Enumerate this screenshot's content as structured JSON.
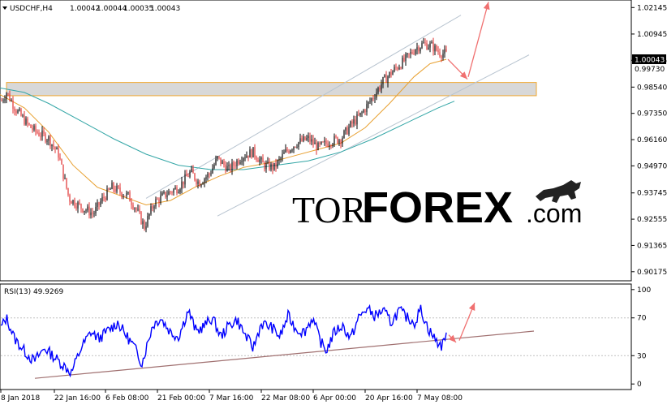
{
  "chart_data": [
    {
      "type": "candlestick",
      "header": {
        "symbol_timeframe": "USDCHF,H4",
        "ohlc": [
          "1.00042",
          "1.00044",
          "1.00035",
          "1.00043"
        ]
      },
      "price_label": "1.00043",
      "sub_price_label": "0.99730",
      "y_ticks": [
        0.90175,
        0.91365,
        0.92555,
        0.93745,
        0.9497,
        0.9616,
        0.9735,
        0.9854,
        0.99755,
        1.00945,
        1.02145
      ],
      "y_tick_labels": [
        "0.90175",
        "0.91365",
        "0.92555",
        "0.93745",
        "0.94970",
        "0.96160",
        "0.97350",
        "0.98540",
        "0.99755",
        "1.00945",
        "1.02145"
      ],
      "ylim": [
        0.898,
        1.0245
      ],
      "x_ticks": [
        "8 Jan 2018",
        "22 Jan 16:00",
        "6 Feb 08:00",
        "21 Feb 00:00",
        "7 Mar 16:00",
        "22 Mar 08:00",
        "6 Apr 00:00",
        "20 Apr 16:00",
        "7 May 08:00"
      ],
      "price_path": [
        [
          0,
          0.978
        ],
        [
          8,
          0.983
        ],
        [
          20,
          0.975
        ],
        [
          35,
          0.968
        ],
        [
          45,
          0.965
        ],
        [
          60,
          0.962
        ],
        [
          72,
          0.955
        ],
        [
          85,
          0.935
        ],
        [
          100,
          0.931
        ],
        [
          115,
          0.928
        ],
        [
          125,
          0.934
        ],
        [
          138,
          0.94
        ],
        [
          148,
          0.938
        ],
        [
          158,
          0.936
        ],
        [
          168,
          0.93
        ],
        [
          178,
          0.922
        ],
        [
          190,
          0.933
        ],
        [
          205,
          0.937
        ],
        [
          220,
          0.94
        ],
        [
          235,
          0.947
        ],
        [
          245,
          0.942
        ],
        [
          258,
          0.946
        ],
        [
          268,
          0.953
        ],
        [
          282,
          0.948
        ],
        [
          298,
          0.954
        ],
        [
          312,
          0.956
        ],
        [
          325,
          0.95
        ],
        [
          338,
          0.949
        ],
        [
          352,
          0.956
        ],
        [
          365,
          0.96
        ],
        [
          380,
          0.962
        ],
        [
          392,
          0.958
        ],
        [
          408,
          0.961
        ],
        [
          420,
          0.962
        ],
        [
          432,
          0.968
        ],
        [
          445,
          0.973
        ],
        [
          458,
          0.98
        ],
        [
          472,
          0.988
        ],
        [
          485,
          0.993
        ],
        [
          500,
          0.998
        ],
        [
          512,
          1.003
        ],
        [
          522,
          1.005
        ],
        [
          532,
          1.004
        ],
        [
          542,
          1.001
        ],
        [
          550,
          1.0004
        ]
      ],
      "ma_fast": [
        [
          0,
          0.982
        ],
        [
          30,
          0.976
        ],
        [
          60,
          0.965
        ],
        [
          90,
          0.95
        ],
        [
          120,
          0.94
        ],
        [
          150,
          0.936
        ],
        [
          180,
          0.932
        ],
        [
          210,
          0.934
        ],
        [
          240,
          0.94
        ],
        [
          270,
          0.945
        ],
        [
          300,
          0.949
        ],
        [
          330,
          0.951
        ],
        [
          360,
          0.954
        ],
        [
          390,
          0.957
        ],
        [
          420,
          0.96
        ],
        [
          450,
          0.967
        ],
        [
          480,
          0.978
        ],
        [
          510,
          0.99
        ],
        [
          530,
          0.996
        ],
        [
          550,
          0.998
        ]
      ],
      "ma_slow": [
        [
          0,
          0.985
        ],
        [
          30,
          0.983
        ],
        [
          60,
          0.978
        ],
        [
          100,
          0.97
        ],
        [
          140,
          0.962
        ],
        [
          180,
          0.955
        ],
        [
          220,
          0.95
        ],
        [
          260,
          0.948
        ],
        [
          300,
          0.948
        ],
        [
          340,
          0.95
        ],
        [
          380,
          0.952
        ],
        [
          420,
          0.956
        ],
        [
          460,
          0.962
        ],
        [
          500,
          0.969
        ],
        [
          540,
          0.976
        ],
        [
          560,
          0.979
        ]
      ],
      "resistance_zone": [
        0.9815,
        0.9875
      ],
      "channel_upper": [
        [
          180,
          0.935
        ],
        [
          568,
          1.018
        ]
      ],
      "channel_lower": [
        [
          268,
          0.927
        ],
        [
          652,
          1.0
        ]
      ],
      "forecast_arrows": [
        [
          [
            552,
            0.998
          ],
          [
            576,
            0.989
          ]
        ],
        [
          [
            577,
            0.99
          ],
          [
            602,
            1.024
          ]
        ]
      ],
      "colors": {
        "bull": "#000000",
        "bear": "#e03030",
        "ma_fast": "#e8a030",
        "ma_slow": "#33a6a6",
        "channel": "#b8c4d0",
        "zone_fill": "#d8d8d8",
        "zone_border": "#f0a830",
        "arrow": "#f07070",
        "price_label_bg": "#000000",
        "price_label_fg": "#ffffff"
      },
      "watermark": {
        "tor": "TOR",
        "forex": "FOREX",
        "com": ".com",
        "colors": {
          "tor": "#222222",
          "forex": "#ff3300",
          "com": "#222222"
        }
      }
    },
    {
      "type": "line",
      "header": "RSI(13) 49.9269",
      "y_ticks": [
        0,
        30,
        70,
        100
      ],
      "ylim": [
        -5,
        105
      ],
      "rsi_path": [
        [
          0,
          58
        ],
        [
          8,
          70
        ],
        [
          18,
          48
        ],
        [
          30,
          35
        ],
        [
          42,
          24
        ],
        [
          55,
          38
        ],
        [
          65,
          30
        ],
        [
          78,
          20
        ],
        [
          88,
          12
        ],
        [
          100,
          38
        ],
        [
          112,
          55
        ],
        [
          122,
          48
        ],
        [
          135,
          58
        ],
        [
          145,
          65
        ],
        [
          155,
          52
        ],
        [
          165,
          40
        ],
        [
          175,
          22
        ],
        [
          188,
          62
        ],
        [
          198,
          70
        ],
        [
          210,
          55
        ],
        [
          220,
          50
        ],
        [
          232,
          78
        ],
        [
          242,
          55
        ],
        [
          252,
          62
        ],
        [
          262,
          70
        ],
        [
          272,
          50
        ],
        [
          282,
          62
        ],
        [
          292,
          68
        ],
        [
          302,
          52
        ],
        [
          312,
          38
        ],
        [
          322,
          64
        ],
        [
          335,
          60
        ],
        [
          345,
          50
        ],
        [
          355,
          72
        ],
        [
          365,
          58
        ],
        [
          375,
          55
        ],
        [
          385,
          70
        ],
        [
          395,
          45
        ],
        [
          402,
          35
        ],
        [
          412,
          55
        ],
        [
          422,
          62
        ],
        [
          432,
          48
        ],
        [
          442,
          70
        ],
        [
          452,
          80
        ],
        [
          462,
          72
        ],
        [
          472,
          78
        ],
        [
          482,
          65
        ],
        [
          492,
          78
        ],
        [
          502,
          70
        ],
        [
          512,
          65
        ],
        [
          518,
          80
        ],
        [
          528,
          58
        ],
        [
          538,
          45
        ],
        [
          545,
          40
        ],
        [
          550,
          56
        ]
      ],
      "trendline": [
        [
          43,
          6
        ],
        [
          658,
          56
        ]
      ],
      "forecast_arrows": [
        [
          [
            553,
            52
          ],
          [
            562,
            44
          ]
        ],
        [
          [
            566,
            46
          ],
          [
            585,
            86
          ]
        ]
      ],
      "colors": {
        "line": "#0000ff",
        "trendline": "#a07070",
        "arrow": "#f07070",
        "level": "#c0c0c0"
      }
    }
  ]
}
